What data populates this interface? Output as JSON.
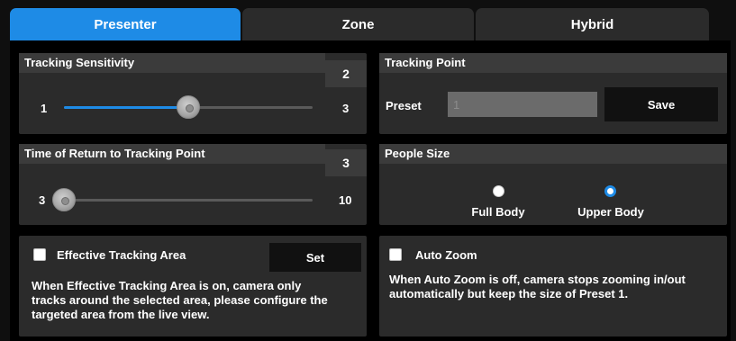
{
  "tabs": [
    {
      "label": "Presenter",
      "active": true
    },
    {
      "label": "Zone",
      "active": false
    },
    {
      "label": "Hybrid",
      "active": false
    }
  ],
  "tracking_sensitivity": {
    "title": "Tracking Sensitivity",
    "value": "2",
    "min_label": "1",
    "max_label": "3",
    "level": 0.5
  },
  "tracking_point": {
    "title": "Tracking Point",
    "preset_label": "Preset",
    "preset_value": "1",
    "save_label": "Save"
  },
  "return_time": {
    "title": "Time of Return to Tracking Point",
    "value": "3",
    "min_label": "3",
    "max_label": "10",
    "level": 0.0
  },
  "people_size": {
    "title": "People Size",
    "options": [
      {
        "label": "Full Body",
        "selected": false
      },
      {
        "label": "Upper Body",
        "selected": true
      }
    ]
  },
  "tracking_area": {
    "checkbox_label": "Effective Tracking Area",
    "checked": false,
    "set_label": "Set",
    "description": "When Effective Tracking Area is on, camera only tracks around the selected area, please configure the targeted area from the live view."
  },
  "auto_zoom": {
    "checkbox_label": "Auto Zoom",
    "checked": false,
    "description": "When Auto Zoom is off, camera stops zooming in/out automatically but keep the size of Preset 1."
  },
  "colors": {
    "accent": "#1e8be6",
    "panel": "#2b2b2b",
    "panel_header": "#3b3b3b"
  }
}
